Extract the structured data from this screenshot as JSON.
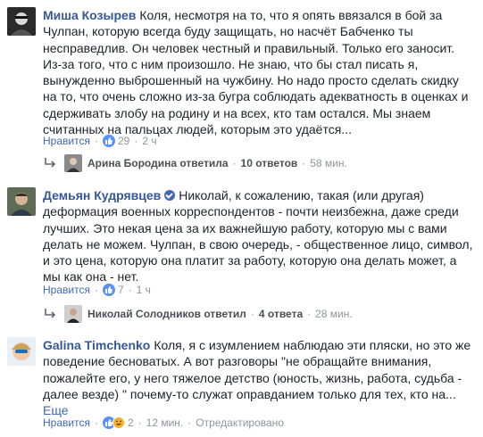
{
  "comments": [
    {
      "author": "Миша Козырев",
      "text": "Коля, несмотря на то, что я опять ввязался в бой за Чулпан, которую всегда буду защищать, но насчёт Бабченко ты несправедлив. Он человек честный и правильный. Только его заносит. Из-за того, что с ним произошло. Не знаю, что бы стал писать я, вынужденно выброшенный на чужбину. Но надо просто сделать скидку на то, что очень сложно из-за бугра соблюдать адекватность в оценках и сдерживать злобу на родину и на всех, кто там остался. Мы знаем считанных на пальцах людей, которым это удаётся...",
      "like_label": "Нравится",
      "reaction_count": "29",
      "time": "2 ч",
      "reply": {
        "name": "Арина Бородина ответила",
        "count": "10 ответов",
        "time": "58 мин."
      }
    },
    {
      "author": "Демьян Кудрявцев",
      "text": "Николай, к сожалению, такая (или другая) деформация военных корреспондентов - почти неизбежна, даже среди лучших. Это некая цена за их важнейшую работу, которую мы с вами делать не можем. Чулпан, в свою очередь, - общественное лицо, символ, и это цена, которую она платит за работу, которую она делать может, а мы как она - нет.",
      "like_label": "Нравится",
      "reaction_count": "7",
      "time": "1 ч",
      "reply": {
        "name": "Николай Солодников ответил",
        "count": "4 ответа",
        "time": "28 мин."
      }
    },
    {
      "author": "Galina Timchenko",
      "text": "Коля, я с изумлением наблюдаю эти пляски, но это же поведение бесноватых. А вот разговоры \"не обращайте внимания, пожалейте его, у него тяжелое детство (юность, жизнь, работа, судьба - далее везде) \" почему-то служат оправданием только для тех, кто на...",
      "more_label": "Еще",
      "like_label": "Нравится",
      "reaction_count": "2",
      "time": "12 мин.",
      "edited": "Отредактировано"
    }
  ],
  "colors": {
    "link": "#4267b2",
    "author": "#365899",
    "muted": "#90949c",
    "like": "#5890ff",
    "haha": "#f7b125"
  }
}
